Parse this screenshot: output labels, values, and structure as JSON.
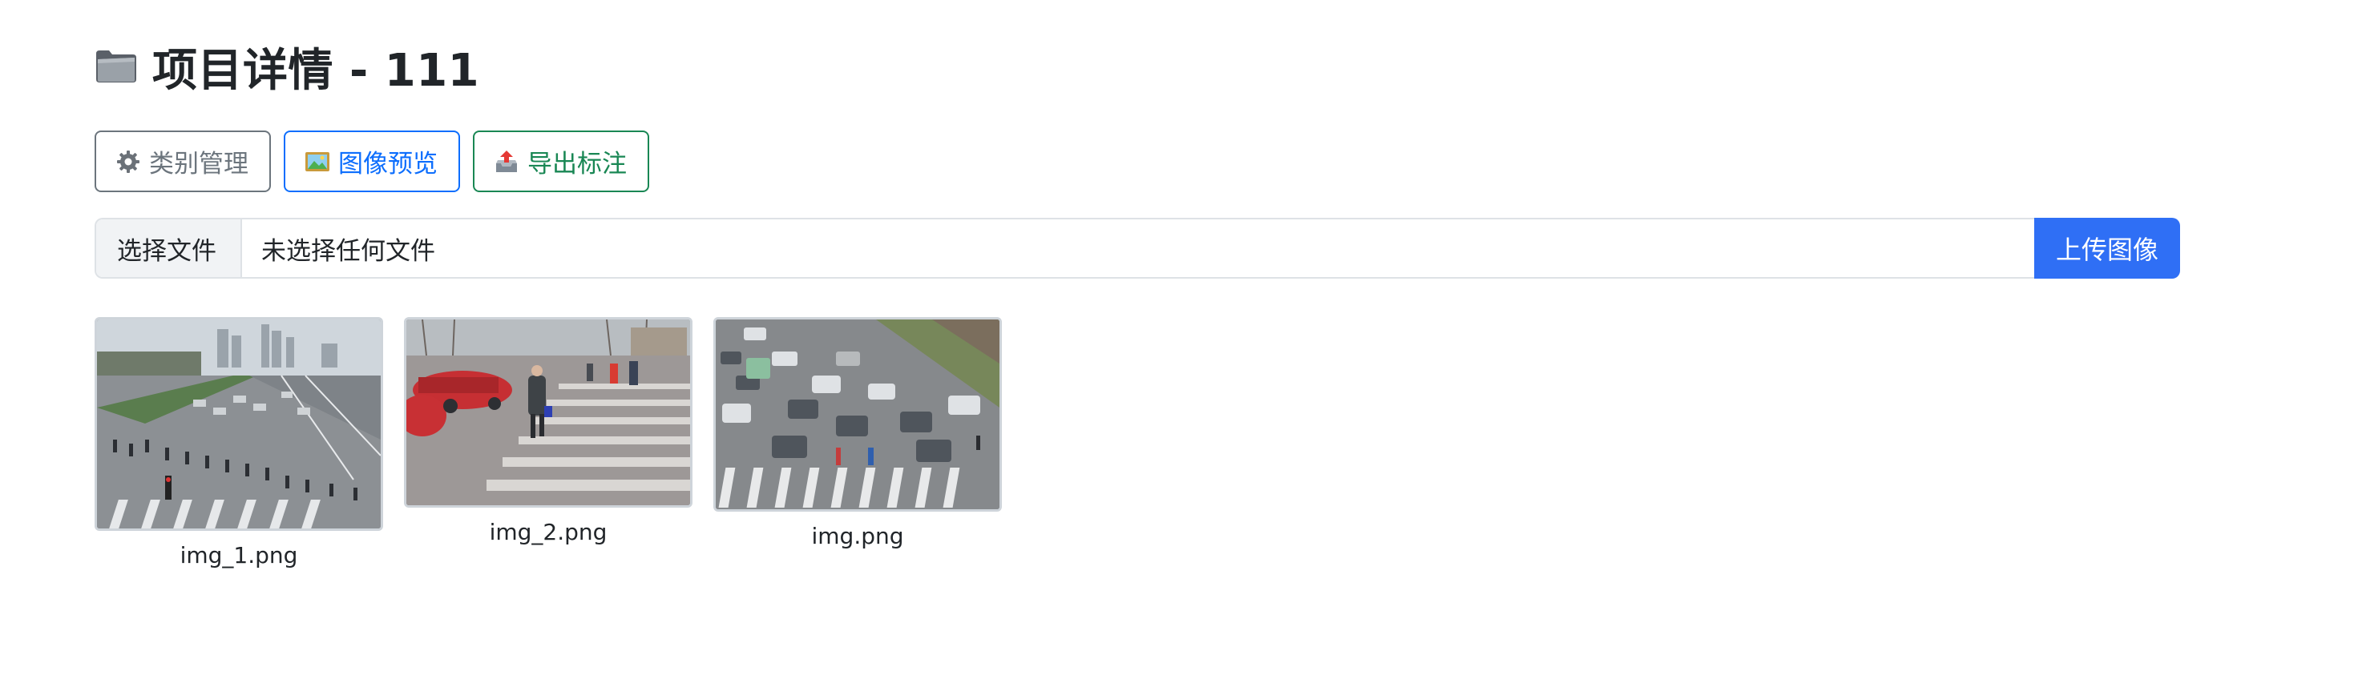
{
  "header": {
    "title": "项目详情 - 111",
    "icon": "folder-icon"
  },
  "toolbar": {
    "category_label": "类别管理",
    "category_icon": "gear-icon",
    "preview_label": "图像预览",
    "preview_icon": "picture-icon",
    "export_label": "导出标注",
    "export_icon": "outbox-tray-icon"
  },
  "upload": {
    "choose_label": "选择文件",
    "file_status": "未选择任何文件",
    "upload_label": "上传图像"
  },
  "images": [
    {
      "filename": "img_1.png"
    },
    {
      "filename": "img_2.png"
    },
    {
      "filename": "img.png"
    }
  ],
  "colors": {
    "primary": "#2f6ff5",
    "secondary": "#6c757d",
    "success": "#198754"
  }
}
